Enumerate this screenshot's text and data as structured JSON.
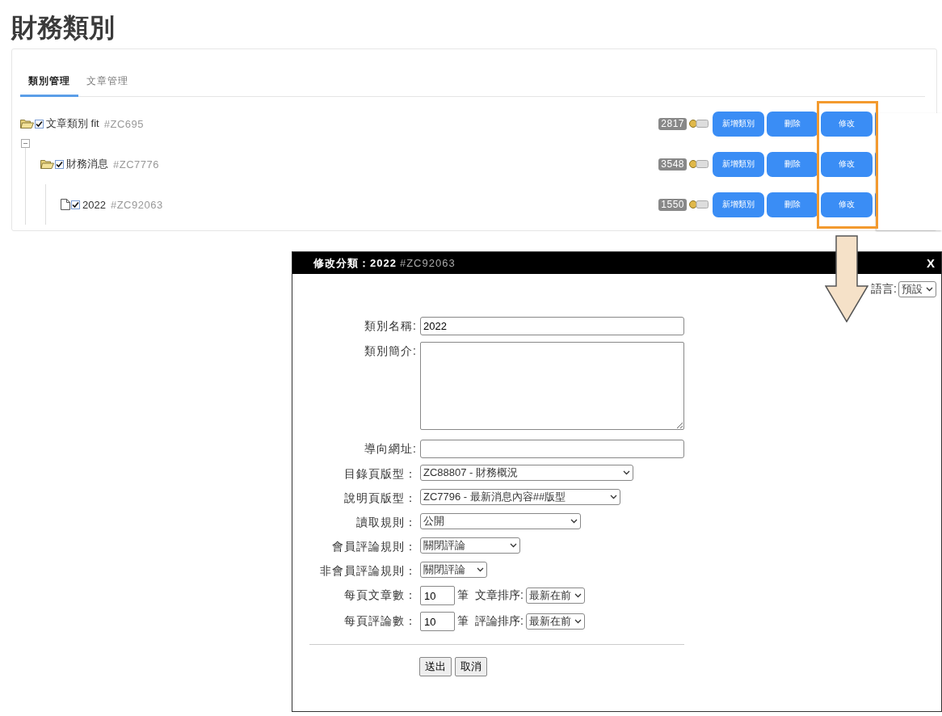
{
  "page_title": "財務類別",
  "tabs": [
    {
      "label": "類別管理",
      "selected": true
    },
    {
      "label": "文章管理",
      "selected": false
    }
  ],
  "tree": [
    {
      "kind": "folder",
      "checked": true,
      "name": "文章類別 fit",
      "code": "#ZC695",
      "count": "2817",
      "expanded": true,
      "actions": [
        "新增類別",
        "刪除",
        "修改"
      ],
      "children": [
        {
          "kind": "folder",
          "checked": true,
          "name": "財務消息",
          "code": "#ZC7776",
          "count": "3548",
          "expanded": false,
          "actions": [
            "新增類別",
            "刪除",
            "修改"
          ],
          "children": [
            {
              "kind": "file",
              "checked": true,
              "name": "2022",
              "code": "#ZC92063",
              "count": "1550",
              "expanded": false,
              "actions": [
                "新增類別",
                "刪除",
                "修改"
              ]
            }
          ]
        }
      ]
    }
  ],
  "dialog": {
    "title": "修改分類：2022",
    "title_code": "#ZC92063",
    "close": "X",
    "language": {
      "label": "語言:",
      "value": "預設"
    },
    "fields": [
      {
        "kind": "text",
        "label": "類別名稱:",
        "value": "2022"
      },
      {
        "kind": "textarea",
        "label": "類別簡介:"
      },
      {
        "kind": "text",
        "label": "導向網址:"
      },
      {
        "kind": "select",
        "label": "目錄頁版型：",
        "value": "ZC88807 - 財務概況"
      },
      {
        "kind": "select",
        "label": "說明頁版型：",
        "value": "ZC7796 - 最新消息內容##版型"
      },
      {
        "kind": "select",
        "label": "讀取規則：",
        "value": "公開"
      },
      {
        "kind": "select",
        "label": "會員評論規則：",
        "value": "關閉評論"
      },
      {
        "kind": "select",
        "label": "非會員評論規則：",
        "value": "關閉評論"
      },
      {
        "kind": "count",
        "label": "每頁文章數：",
        "value": "10",
        "unit": "筆",
        "sort_label": "文章排序:",
        "sort_value": "最新在前"
      },
      {
        "kind": "count",
        "label": "每頁評論數：",
        "value": "10",
        "unit": "筆",
        "sort_label": "評論排序:",
        "sort_value": "最新在前"
      }
    ],
    "buttons": [
      "送出",
      "取消"
    ]
  }
}
